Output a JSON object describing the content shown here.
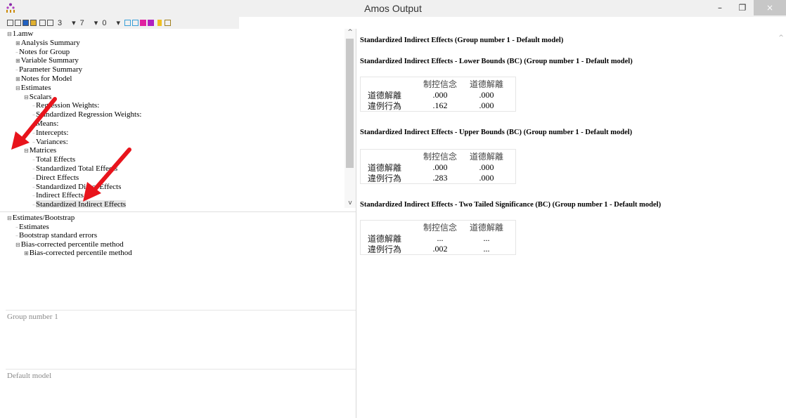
{
  "window": {
    "title": "Amos Output",
    "controls": {
      "minimize": "–",
      "restore": "❐",
      "close": "×"
    }
  },
  "toolbar": {
    "decimals": "3",
    "drop1": "7",
    "drop2": "0"
  },
  "tree": {
    "items": [
      {
        "label": "1.amw",
        "expander": "⊟",
        "indent": 0
      },
      {
        "label": "Analysis Summary",
        "expander": "⊞",
        "indent": 1
      },
      {
        "label": "Notes for Group",
        "expander": "",
        "indent": 1
      },
      {
        "label": "Variable Summary",
        "expander": "⊞",
        "indent": 1
      },
      {
        "label": "Parameter Summary",
        "expander": "",
        "indent": 1
      },
      {
        "label": "Notes for Model",
        "expander": "⊞",
        "indent": 1
      },
      {
        "label": "Estimates",
        "expander": "⊟",
        "indent": 1
      },
      {
        "label": "Scalars",
        "expander": "⊟",
        "indent": 2
      },
      {
        "label": "Regression Weights:",
        "expander": "",
        "indent": 3
      },
      {
        "label": "Standardized Regression Weights:",
        "expander": "",
        "indent": 3
      },
      {
        "label": "Means:",
        "expander": "",
        "indent": 3
      },
      {
        "label": "Intercepts:",
        "expander": "",
        "indent": 3
      },
      {
        "label": "Variances:",
        "expander": "",
        "indent": 3
      },
      {
        "label": "Matrices",
        "expander": "⊟",
        "indent": 2
      },
      {
        "label": "Total Effects",
        "expander": "",
        "indent": 3
      },
      {
        "label": "Standardized Total Effects",
        "expander": "",
        "indent": 3
      },
      {
        "label": "Direct Effects",
        "expander": "",
        "indent": 3
      },
      {
        "label": "Standardized Direct Effects",
        "expander": "",
        "indent": 3
      },
      {
        "label": "Indirect Effects",
        "expander": "",
        "indent": 3
      },
      {
        "label": "Standardized Indirect Effects",
        "expander": "",
        "indent": 3,
        "selected": true
      }
    ],
    "bottom_items": [
      {
        "label": "Estimates/Bootstrap",
        "expander": "⊟",
        "indent": 0
      },
      {
        "label": "Estimates",
        "expander": "",
        "indent": 1
      },
      {
        "label": "Bootstrap standard errors",
        "expander": "",
        "indent": 1
      },
      {
        "label": "Bias-corrected percentile method",
        "expander": "⊟",
        "indent": 1
      },
      {
        "label": "Bias-corrected percentile method",
        "expander": "⊞",
        "indent": 2
      }
    ]
  },
  "groups": {
    "group_label": "Group number 1",
    "model_label": "Default model"
  },
  "output": {
    "heading_main": "Standardized Indirect Effects (Group number 1 - Default model)",
    "sections": [
      {
        "heading": "Standardized Indirect Effects - Lower Bounds (BC) (Group number 1 - Default model)",
        "columns": [
          "",
          "制控信念",
          "道德解離"
        ],
        "rows": [
          [
            "道德解離",
            ".000",
            ".000"
          ],
          [
            "違例行為",
            ".162",
            ".000"
          ]
        ]
      },
      {
        "heading": "Standardized Indirect Effects - Upper Bounds (BC) (Group number 1 - Default model)",
        "columns": [
          "",
          "制控信念",
          "道德解離"
        ],
        "rows": [
          [
            "道德解離",
            ".000",
            ".000"
          ],
          [
            "違例行為",
            ".283",
            ".000"
          ]
        ]
      },
      {
        "heading": "Standardized Indirect Effects - Two Tailed Significance (BC) (Group number 1 - Default model)",
        "columns": [
          "",
          "制控信念",
          "道德解離"
        ],
        "rows": [
          [
            "道德解離",
            "...",
            "..."
          ],
          [
            "違例行為",
            ".002",
            "..."
          ]
        ]
      }
    ]
  },
  "colors": {
    "arrow": "#e8141c",
    "selection": "#e6e6e6"
  }
}
